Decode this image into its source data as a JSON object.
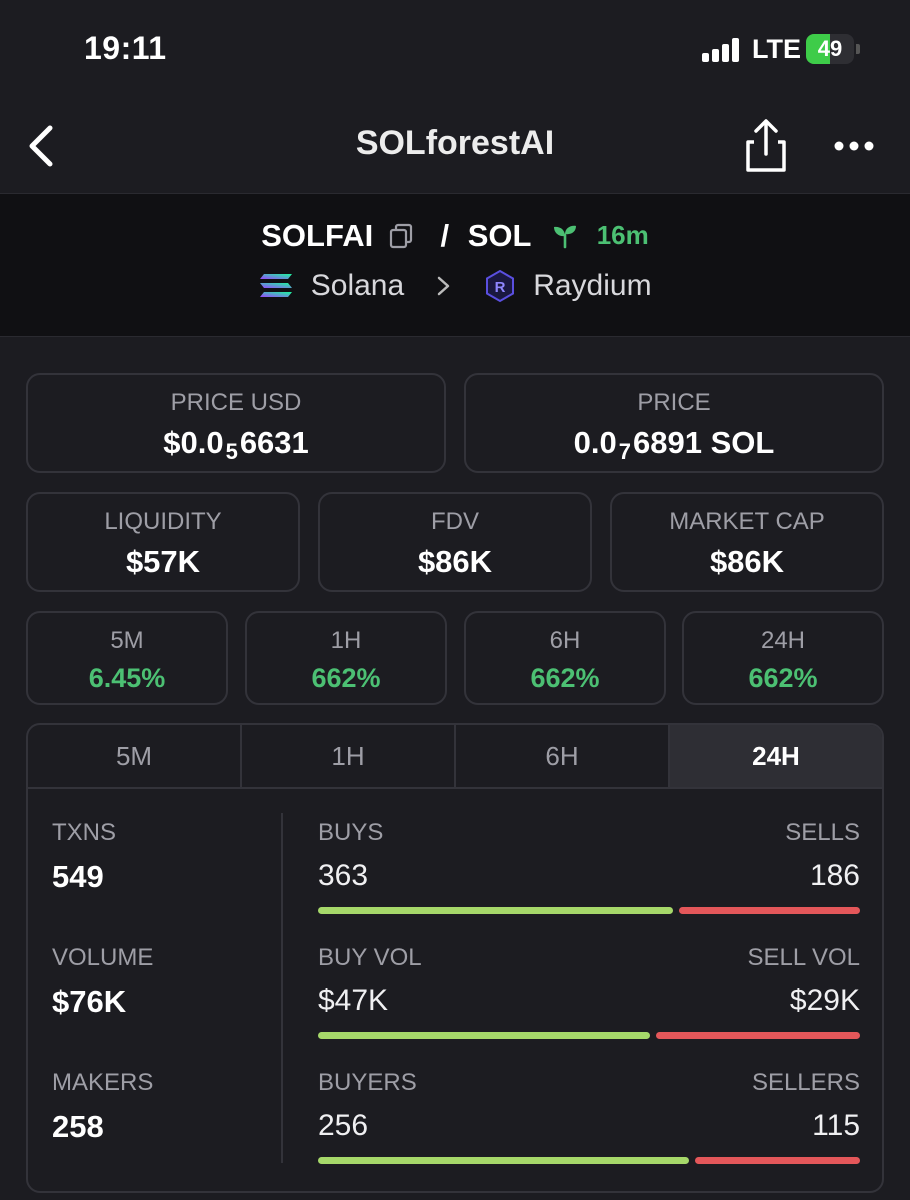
{
  "status": {
    "time": "19:11",
    "network": "LTE",
    "battery": "49",
    "battery_level": 49
  },
  "nav": {
    "title": "SOLforestAI"
  },
  "token": {
    "base": "SOLFAI",
    "separator": "/",
    "quote": "SOL",
    "age": "16m",
    "chain": "Solana",
    "dex": "Raydium"
  },
  "prices": {
    "usd_label": "PRICE USD",
    "usd_prefix": "$0.0",
    "usd_zeros": "5",
    "usd_digits": "6631",
    "native_label": "PRICE",
    "native_prefix": "0.0",
    "native_zeros": "7",
    "native_digits": "6891 SOL"
  },
  "metrics": [
    {
      "label": "LIQUIDITY",
      "value": "$57K"
    },
    {
      "label": "FDV",
      "value": "$86K"
    },
    {
      "label": "MARKET CAP",
      "value": "$86K"
    }
  ],
  "changes": [
    {
      "label": "5M",
      "value": "6.45%"
    },
    {
      "label": "1H",
      "value": "662%"
    },
    {
      "label": "6H",
      "value": "662%"
    },
    {
      "label": "24H",
      "value": "662%"
    }
  ],
  "tabs": [
    "5M",
    "1H",
    "6H",
    "24H"
  ],
  "active_tab": "24H",
  "txns": {
    "left": [
      {
        "label": "TXNS",
        "value": "549"
      },
      {
        "label": "VOLUME",
        "value": "$76K"
      },
      {
        "label": "MAKERS",
        "value": "258"
      }
    ],
    "splits": [
      {
        "left_label": "BUYS",
        "left_value": "363",
        "right_label": "SELLS",
        "right_value": "186",
        "ratio": 0.661
      },
      {
        "left_label": "BUY VOL",
        "left_value": "$47K",
        "right_label": "SELL VOL",
        "right_value": "$29K",
        "ratio": 0.618
      },
      {
        "left_label": "BUYERS",
        "left_value": "256",
        "right_label": "SELLERS",
        "right_value": "115",
        "ratio": 0.69
      }
    ]
  },
  "colors": {
    "positive": "#4cc073",
    "buy_bar": "#a6d86a",
    "sell_bar": "#e4575a",
    "background": "#1c1c21"
  }
}
